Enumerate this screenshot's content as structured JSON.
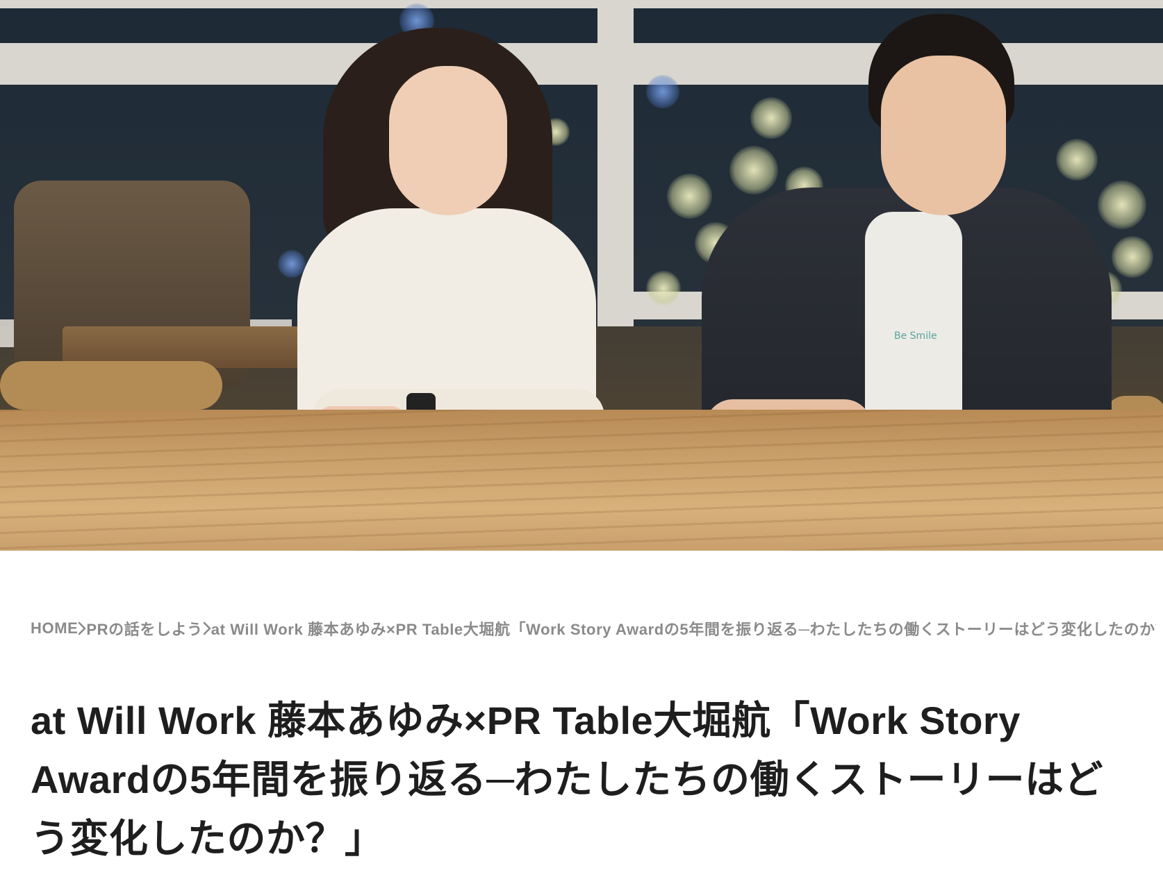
{
  "hero": {
    "alt": "Photo of two people smiling at a wooden table",
    "shirt_text": "Be Smile"
  },
  "breadcrumb": {
    "items": [
      {
        "label": "HOME"
      },
      {
        "label": "PRの話をしよう"
      },
      {
        "label": "at Will Work 藤本あゆみ×PR Table大堀航「Work Story Awardの5年間を振り返る─わたしたちの働くストーリーはどう変化したのか？」"
      }
    ],
    "separator_icon": "chevron-right-icon"
  },
  "article": {
    "title": "at Will Work 藤本あゆみ×PR Table大堀航「Work Story Awardの5年間を振り返る─わたしたちの働くストーリーはどう変化したのか？」"
  },
  "colors": {
    "breadcrumb_text": "#8a8a8a",
    "title_text": "#1e1e1e",
    "background": "#ffffff"
  }
}
